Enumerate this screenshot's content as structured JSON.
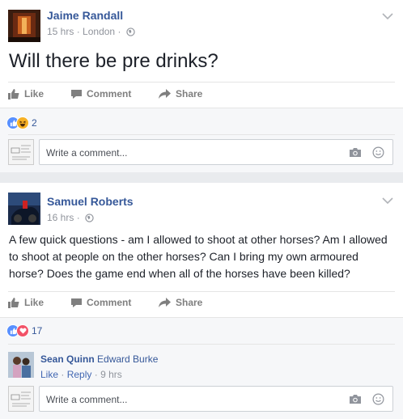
{
  "post1": {
    "author": "Jaime Randall",
    "time": "15 hrs",
    "location": "London",
    "separator": "·",
    "text": "Will there be pre drinks?",
    "actions": {
      "like": "Like",
      "comment": "Comment",
      "share": "Share"
    },
    "reaction_count": "2",
    "comment_placeholder": "Write a comment..."
  },
  "post2": {
    "author": "Samuel Roberts",
    "time": "16 hrs",
    "separator": "·",
    "text": "A few quick questions - am I allowed to shoot at other horses? Am I allowed to shoot at people on the other horses? Can I bring my own armoured horse? Does the game end when all of the horses have been killed?",
    "actions": {
      "like": "Like",
      "comment": "Comment",
      "share": "Share"
    },
    "reaction_count": "17",
    "reply": {
      "author": "Sean Quinn",
      "tagged": "Edward Burke",
      "like": "Like",
      "reply": "Reply",
      "time": "9 hrs",
      "dot": "·"
    },
    "comment_placeholder": "Write a comment..."
  },
  "colors": {
    "link_blue": "#365899",
    "like_blue": "#5890ff",
    "love_red": "#f25268",
    "haha_yellow": "#f7b125"
  }
}
